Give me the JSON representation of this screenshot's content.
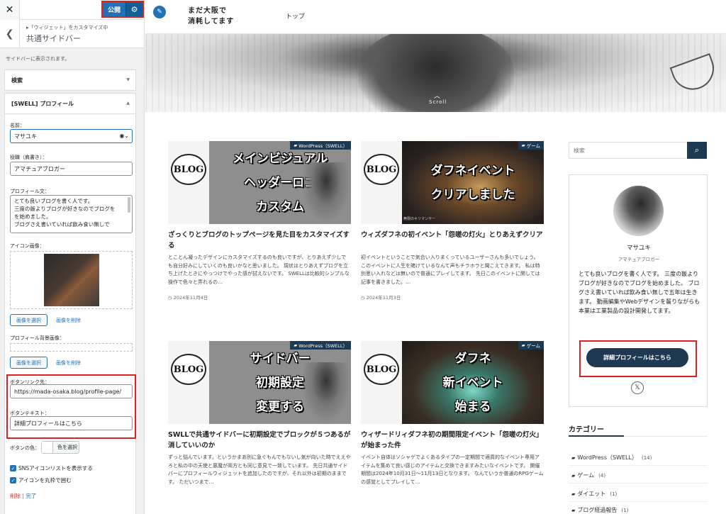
{
  "customizer": {
    "close_icon": "close-icon",
    "publish_label": "公開",
    "breadcrumb": "▸「ウィジェット」をカスタマイズ中",
    "section_title": "共通サイドバー",
    "sidebar_desc": "サイドバーに表示されます。",
    "widget_search": "検索",
    "widget_profile": "[SWELL] プロフィール",
    "form": {
      "name_label": "名前：",
      "name_value": "マサユキ",
      "role_label": "役職（肩書き）：",
      "role_value": "アマチュアブロガー",
      "bio_label": "プロフィール文：",
      "bio_lines": [
        "とても良いブログを書く人です。",
        "三度の飯よりブログが好きなのでブログを",
        "を始めました。",
        "ブログさえ書いていれば飲み食い無しで"
      ],
      "icon_label": "アイコン画像：",
      "select_image": "画像を選択",
      "delete_image": "画像を削除",
      "bg_label": "プロフィール背景画像：",
      "link_label": "ボタンリンク先：",
      "link_value": "https://mada-osaka.blog/profile-page/",
      "btn_text_label": "ボタンテキスト：",
      "btn_text_value": "詳細プロフィールはこちら",
      "btn_color_label": "ボタンの色：",
      "color_select": "色を選択",
      "sns_check": "SNSアイコンリストを表示する",
      "round_check": "アイコンを丸枠で囲む",
      "delete_link": "削除",
      "separator": "|",
      "done_link": "完了"
    }
  },
  "site": {
    "logo_line1": "まだ大阪で",
    "logo_line2": "消耗してます",
    "nav_top": "トップ",
    "scroll_label": "Scroll",
    "scroll_chevron": "︿"
  },
  "posts": [
    {
      "category": "WordPress（SWELL）",
      "thumb_text": "メインビジュアル\nヘッダーロゴ\nカスタム",
      "thumb_caption": "",
      "title": "ざっくりとブログのトップページを見た目をカスタマイズする",
      "excerpt": "とことん凝ったデザインにカスタマイズするのも良いですが、とりあえず少しでも自分好みにしていくのも良いかなと思いました。 現状はとりあえずブログを立ち上げたときにやっつけでやった感が拭えないです。 SWELLは比較的シンプルな操作で色々と弄れるの…",
      "date": "2024年11月4日"
    },
    {
      "category": "ゲーム",
      "thumb_text": "ダフネイベント\nクリアしました",
      "thumb_caption": "無限のキリマンサー",
      "title": "ウィズダフネの初イベント「怨嗟の灯火」とりあえずクリア",
      "excerpt": "初イベントということで気合い入りまくっているユーザーさんも多いでしょう。 このイベントに人生を賭けているなんて声もチラホラと聞こえてきます。 私は特別思い入れなどは無いので普通にプレイしてます。 先日このイベントに関しては記事を書きました。…",
      "date": "2024年11月3日"
    },
    {
      "category": "WordPress（SWELL）",
      "thumb_text": "サイドバー\n初期設定\n変更する",
      "thumb_caption": "",
      "title": "SWLLで共通サイドバーに初期設定でブロックが５つあるが消していいのか",
      "excerpt": "ずっと悩んでいます。というかまあ別に急ぐもんでもないし気が向いた時でええやろと私の中の天使と悪魔が両方とも同じ意見で一致しています。 先日共通サイドバーにプロフィールウィジェットを追加したのですが、それ以外は初期のままです。 ただいつまで…",
      "date": ""
    },
    {
      "category": "ゲーム",
      "thumb_text": "ダフネ\n新イベント\n始まる",
      "thumb_caption": "",
      "title": "ウィザードリィダフネ初の期間限定イベント「怨嗟の灯火」が始まった件",
      "excerpt": "イベント自体はソシャゲでよくあるタイプの一定期間で適貨的なイベント専用アイテムを集めて良い感じのアイテムと交換できますみたいなイベントです。 開催期間は2024年10月31日〜11月13日となります。 なんていうか普通のRPGゲームの感覚としてプレイして…",
      "date": ""
    }
  ],
  "sidebar": {
    "search_placeholder": "検索",
    "search_icon": "search-icon",
    "profile": {
      "name": "マサユキ",
      "role": "アマチュアブロガー",
      "bio": "とても良いブログを書く人です。 三度の飯よりブログが好きなのでブログを始めました。 ブログさえ書いていれば飲み食い無しで五年は生きます。 動画編集やWebデザインを齧りながらも本業は工業製品の設計開発してます。",
      "button": "詳細プロフィールはこちら",
      "x_label": "𝕏"
    },
    "category_heading": "カテゴリー",
    "categories": [
      {
        "name": "WordPress（SWELL）",
        "count": "(14)"
      },
      {
        "name": "ゲーム",
        "count": "(4)"
      },
      {
        "name": "ダイエット",
        "count": "(1)"
      },
      {
        "name": "ブログ経過報告",
        "count": "(1)"
      }
    ]
  },
  "colors": {
    "accent": "#2271b1",
    "site_navy": "#1d3a52",
    "highlight_red": "#e02020"
  }
}
